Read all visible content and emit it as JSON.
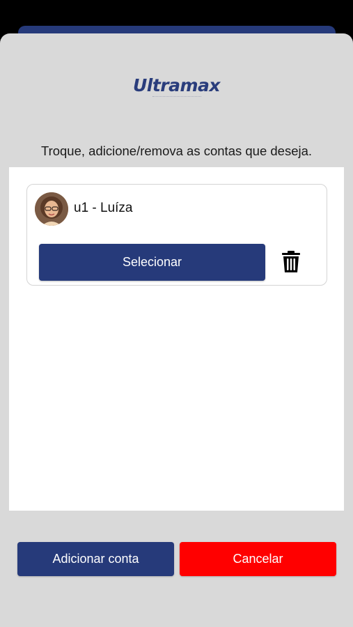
{
  "brand": {
    "logo_text": "Ultramax",
    "primary_color": "#263a7a",
    "danger_color": "#ff0000"
  },
  "instruction": "Troque, adicione/remova as contas que deseja.",
  "accounts": [
    {
      "name": "u1 - Luíza",
      "select_label": "Selecionar",
      "avatar_icon": "user-avatar-photo",
      "delete_icon": "trash-icon"
    }
  ],
  "actions": {
    "add_label": "Adicionar conta",
    "cancel_label": "Cancelar"
  }
}
